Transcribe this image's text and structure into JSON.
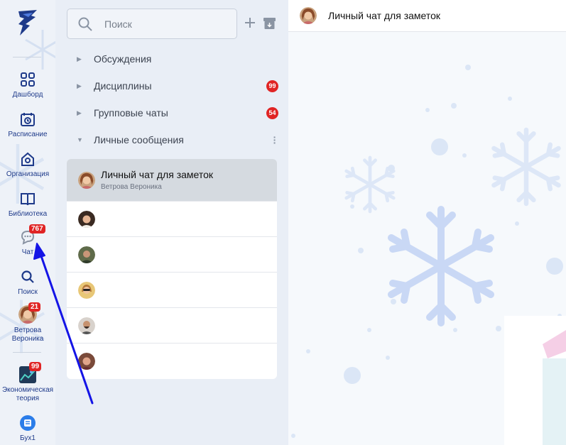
{
  "rail": {
    "items": [
      {
        "label": "Дашборд",
        "icon": "dashboard-icon"
      },
      {
        "label": "Расписание",
        "icon": "calendar-icon"
      },
      {
        "label": "Организация",
        "icon": "organization-icon"
      },
      {
        "label": "Библиотека",
        "icon": "book-icon"
      },
      {
        "label": "Чат",
        "icon": "chat-icon",
        "badge": "767"
      },
      {
        "label": "Поиск",
        "icon": "search-icon"
      },
      {
        "label": "Ветрова Вероника",
        "icon": "profile-avatar",
        "badge": "21"
      },
      {
        "label": "Экономическая теория",
        "icon": "course-avatar",
        "badge": "99"
      },
      {
        "label": "Бух1",
        "icon": "bux1-avatar"
      }
    ]
  },
  "search": {
    "placeholder": "Поиск"
  },
  "sections": [
    {
      "label": "Обсуждения",
      "expanded": false
    },
    {
      "label": "Дисциплины",
      "expanded": false,
      "badge": "99"
    },
    {
      "label": "Групповые чаты",
      "expanded": false,
      "badge": "54"
    },
    {
      "label": "Личные сообщения",
      "expanded": true
    }
  ],
  "chats": [
    {
      "title": "Личный чат для заметок",
      "subtitle": "Ветрова Вероника",
      "active": true
    },
    {
      "title": "",
      "subtitle": "",
      "active": false
    },
    {
      "title": "",
      "subtitle": "",
      "active": false
    },
    {
      "title": "",
      "subtitle": "",
      "active": false
    },
    {
      "title": "",
      "subtitle": "",
      "active": false
    },
    {
      "title": "",
      "subtitle": "",
      "active": false
    }
  ],
  "conversation": {
    "title": "Личный чат для заметок"
  },
  "colors": {
    "accent": "#1e3a8a",
    "badge": "#e02424",
    "arrow": "#1414e6"
  }
}
